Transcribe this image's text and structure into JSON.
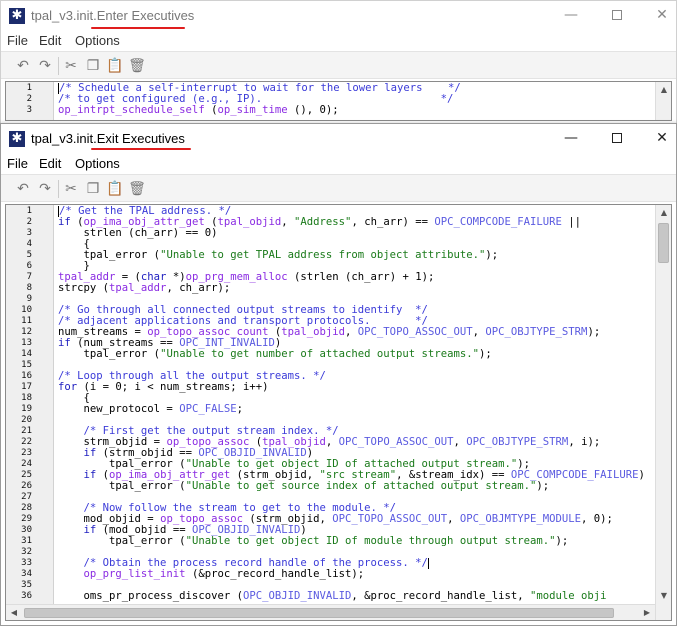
{
  "window_back": {
    "title_prefix": "tpal_v3.init.",
    "title_highlight": "Enter Executives",
    "menu": [
      "File",
      "Edit",
      "Options"
    ],
    "lines": [
      {
        "num": "1",
        "parts": [
          {
            "t": "cursor"
          },
          {
            "c": "cm",
            "s": "/* Schedule a self-interrupt to wait for the lower layers    */"
          }
        ]
      },
      {
        "num": "2",
        "parts": [
          {
            "c": "cm",
            "s": "/* to get configured (e.g., IP).                            */"
          }
        ]
      },
      {
        "num": "3",
        "parts": [
          {
            "c": "fn",
            "s": "op_intrpt_schedule_self"
          },
          {
            "s": " ("
          },
          {
            "c": "fn",
            "s": "op_sim_time"
          },
          {
            "s": " (), 0);"
          }
        ]
      }
    ]
  },
  "window_front": {
    "title_prefix": "tpal_v3.init.",
    "title_highlight": "Exit Executives",
    "menu": [
      "File",
      "Edit",
      "Options"
    ],
    "lines": [
      {
        "num": "1",
        "parts": [
          {
            "t": "cursor"
          },
          {
            "c": "cm",
            "s": "/* Get the TPAL address. */"
          }
        ]
      },
      {
        "num": "2",
        "parts": [
          {
            "c": "kw",
            "s": "if"
          },
          {
            "s": " ("
          },
          {
            "c": "fn",
            "s": "op_ima_obj_attr_get"
          },
          {
            "s": " ("
          },
          {
            "c": "fn",
            "s": "tpal_objid"
          },
          {
            "s": ", "
          },
          {
            "c": "str",
            "s": "\"Address\""
          },
          {
            "s": ", ch_arr) == "
          },
          {
            "c": "const",
            "s": "OPC_COMPCODE_FAILURE"
          },
          {
            "s": " ||"
          }
        ]
      },
      {
        "num": "3",
        "parts": [
          {
            "s": "    strlen (ch_arr) == 0)"
          }
        ]
      },
      {
        "num": "4",
        "parts": [
          {
            "s": "    {"
          }
        ]
      },
      {
        "num": "5",
        "parts": [
          {
            "s": "    tpal_error ("
          },
          {
            "c": "str",
            "s": "\"Unable to get TPAL address from object attribute.\""
          },
          {
            "s": ");"
          }
        ]
      },
      {
        "num": "6",
        "parts": [
          {
            "s": "    }"
          }
        ]
      },
      {
        "num": "7",
        "parts": [
          {
            "c": "fn",
            "s": "tpal_addr"
          },
          {
            "s": " = ("
          },
          {
            "c": "kw",
            "s": "char"
          },
          {
            "s": " *)"
          },
          {
            "c": "fn",
            "s": "op_prg_mem_alloc"
          },
          {
            "s": " (strlen (ch_arr) + 1);"
          }
        ]
      },
      {
        "num": "8",
        "parts": [
          {
            "s": "strcpy ("
          },
          {
            "c": "fn",
            "s": "tpal_addr"
          },
          {
            "s": ", ch_arr);"
          }
        ]
      },
      {
        "num": "9",
        "parts": []
      },
      {
        "num": "10",
        "parts": [
          {
            "c": "cm",
            "s": "/* Go through all connected output streams to identify  */"
          }
        ]
      },
      {
        "num": "11",
        "parts": [
          {
            "c": "cm",
            "s": "/* adjacent applications and transport protocols.       */"
          }
        ]
      },
      {
        "num": "12",
        "parts": [
          {
            "s": "num_streams = "
          },
          {
            "c": "fn",
            "s": "op_topo_assoc_count"
          },
          {
            "s": " ("
          },
          {
            "c": "fn",
            "s": "tpal_objid"
          },
          {
            "s": ", "
          },
          {
            "c": "const",
            "s": "OPC_TOPO_ASSOC_OUT"
          },
          {
            "s": ", "
          },
          {
            "c": "const",
            "s": "OPC_OBJTYPE_STRM"
          },
          {
            "s": ");"
          }
        ]
      },
      {
        "num": "13",
        "parts": [
          {
            "c": "kw",
            "s": "if"
          },
          {
            "s": " (num_streams == "
          },
          {
            "c": "const",
            "s": "OPC_INT_INVALID"
          },
          {
            "s": ")"
          }
        ]
      },
      {
        "num": "14",
        "parts": [
          {
            "s": "    tpal_error ("
          },
          {
            "c": "str",
            "s": "\"Unable to get number of attached output streams.\""
          },
          {
            "s": ");"
          }
        ]
      },
      {
        "num": "15",
        "parts": []
      },
      {
        "num": "16",
        "parts": [
          {
            "c": "cm",
            "s": "/* Loop through all the output streams. */"
          }
        ]
      },
      {
        "num": "17",
        "parts": [
          {
            "c": "kw",
            "s": "for"
          },
          {
            "s": " (i = 0; i < num_streams; i++)"
          }
        ]
      },
      {
        "num": "18",
        "parts": [
          {
            "s": "    {"
          }
        ]
      },
      {
        "num": "19",
        "parts": [
          {
            "s": "    new_protocol = "
          },
          {
            "c": "const",
            "s": "OPC_FALSE"
          },
          {
            "s": ";"
          }
        ]
      },
      {
        "num": "20",
        "parts": []
      },
      {
        "num": "21",
        "parts": [
          {
            "s": "    "
          },
          {
            "c": "cm",
            "s": "/* First get the output stream index. */"
          }
        ]
      },
      {
        "num": "22",
        "parts": [
          {
            "s": "    strm_objid = "
          },
          {
            "c": "fn",
            "s": "op_topo_assoc"
          },
          {
            "s": " ("
          },
          {
            "c": "fn",
            "s": "tpal_objid"
          },
          {
            "s": ", "
          },
          {
            "c": "const",
            "s": "OPC_TOPO_ASSOC_OUT"
          },
          {
            "s": ", "
          },
          {
            "c": "const",
            "s": "OPC_OBJTYPE_STRM"
          },
          {
            "s": ", i);"
          }
        ]
      },
      {
        "num": "23",
        "parts": [
          {
            "s": "    "
          },
          {
            "c": "kw",
            "s": "if"
          },
          {
            "s": " (strm_objid == "
          },
          {
            "c": "const",
            "s": "OPC_OBJID_INVALID"
          },
          {
            "s": ")"
          }
        ]
      },
      {
        "num": "24",
        "parts": [
          {
            "s": "        tpal_error ("
          },
          {
            "c": "str",
            "s": "\"Unable to get object ID of attached output stream.\""
          },
          {
            "s": ");"
          }
        ]
      },
      {
        "num": "25",
        "parts": [
          {
            "s": "    "
          },
          {
            "c": "kw",
            "s": "if"
          },
          {
            "s": " ("
          },
          {
            "c": "fn",
            "s": "op_ima_obj_attr_get"
          },
          {
            "s": " (strm_objid, "
          },
          {
            "c": "str",
            "s": "\"src stream\""
          },
          {
            "s": ", &stream_idx) == "
          },
          {
            "c": "const",
            "s": "OPC_COMPCODE_FAILURE"
          },
          {
            "s": ")"
          }
        ]
      },
      {
        "num": "26",
        "parts": [
          {
            "s": "        tpal_error ("
          },
          {
            "c": "str",
            "s": "\"Unable to get source index of attached output stream.\""
          },
          {
            "s": ");"
          }
        ]
      },
      {
        "num": "27",
        "parts": []
      },
      {
        "num": "28",
        "parts": [
          {
            "s": "    "
          },
          {
            "c": "cm",
            "s": "/* Now follow the stream to get to the module. */"
          }
        ]
      },
      {
        "num": "29",
        "parts": [
          {
            "s": "    mod_objid = "
          },
          {
            "c": "fn",
            "s": "op_topo_assoc"
          },
          {
            "s": " (strm_objid, "
          },
          {
            "c": "const",
            "s": "OPC_TOPO_ASSOC_OUT"
          },
          {
            "s": ", "
          },
          {
            "c": "const",
            "s": "OPC_OBJMTYPE_MODULE"
          },
          {
            "s": ", 0);"
          }
        ]
      },
      {
        "num": "30",
        "parts": [
          {
            "s": "    "
          },
          {
            "c": "kw",
            "s": "if"
          },
          {
            "s": " (mod_objid == "
          },
          {
            "c": "const",
            "s": "OPC_OBJID_INVALID"
          },
          {
            "s": ")"
          }
        ]
      },
      {
        "num": "31",
        "parts": [
          {
            "s": "        tpal_error ("
          },
          {
            "c": "str",
            "s": "\"Unable to get object ID of module through output stream.\""
          },
          {
            "s": ");"
          }
        ]
      },
      {
        "num": "32",
        "parts": []
      },
      {
        "num": "33",
        "parts": [
          {
            "s": "    "
          },
          {
            "c": "cm",
            "s": "/* Obtain the process record handle of the process. */"
          },
          {
            "t": "cursor"
          }
        ]
      },
      {
        "num": "34",
        "parts": [
          {
            "s": "    "
          },
          {
            "c": "fn",
            "s": "op_prg_list_init"
          },
          {
            "s": " (&proc_record_handle_list);"
          }
        ]
      },
      {
        "num": "35",
        "parts": []
      },
      {
        "num": "36",
        "parts": [
          {
            "s": "    oms_pr_process_discover ("
          },
          {
            "c": "const",
            "s": "OPC_OBJID_INVALID"
          },
          {
            "s": ", &proc_record_handle_list, "
          },
          {
            "c": "str",
            "s": "\"module obji"
          }
        ]
      }
    ]
  },
  "colors": {
    "title_underline": "#e01e1e",
    "comment": "#3b3bd8",
    "keyword": "#2020c0",
    "function": "#8a2be2",
    "constant": "#5a5ae0",
    "string": "#1a7a1a"
  }
}
